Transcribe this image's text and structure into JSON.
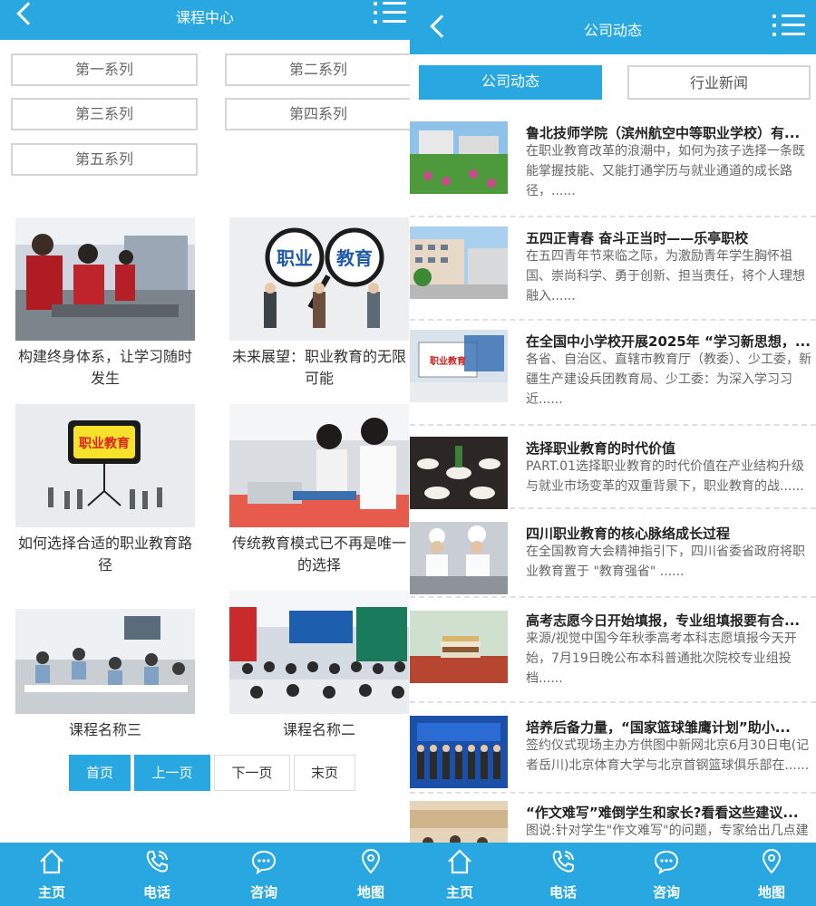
{
  "left": {
    "header_title": "课程中心",
    "series": [
      "第一系列",
      "第二系列",
      "第三系列",
      "第四系列",
      "第五系列"
    ],
    "courses": [
      {
        "caption": "构建终身体系，让学习随时发生",
        "image": "students-workshop-photo"
      },
      {
        "caption": "未来展望：职业教育的无限可能",
        "image": "magnifier-vocational-photo"
      },
      {
        "caption": "如何选择合适的职业教育路径",
        "image": "vocational-sign-photo"
      },
      {
        "caption": "传统教育模式已不再是唯一的选择",
        "image": "students-electronics-photo"
      },
      {
        "caption": "课程名称三",
        "image": "classroom-photo"
      },
      {
        "caption": "课程名称二",
        "image": "auditorium-photo"
      }
    ],
    "pagination": [
      "首页",
      "上一页",
      "下一页",
      "末页"
    ],
    "page_image_texts": {
      "magnifier_1": "职业",
      "magnifier_2": "教育",
      "sign": "职业教育"
    }
  },
  "right": {
    "header_title": "公司动态",
    "tabs": [
      "公司动态",
      "行业新闻"
    ],
    "news": [
      {
        "title": "鲁北技师学院（滨州航空中等职业学校）有...",
        "summary": "在职业教育改革的浪潮中，如何为孩子选择一条既能掌握技能、又能打通学历与就业通道的成长路径，......",
        "image": "campus-photo"
      },
      {
        "title": "五四正青春 奋斗正当时——乐亭职校",
        "summary": "在五四青年节来临之际，为激励青年学生胸怀祖国、崇尚科学、勇于创新、担当责任，将个人理想融入......",
        "image": "building-photo"
      },
      {
        "title": "在全国中小学校开展2025年 “学习新思想，...",
        "summary": "各省、自治区、直辖市教育厅（教委）、少工委，新疆生产建设兵团教育局、少工委：为深入学习习近......",
        "image": "vocational-card-photo"
      },
      {
        "title": "选择职业教育的时代价值",
        "summary": "PART.01选择职业教育的时代价值在产业结构升级与就业市场变革的双重背景下，职业教育的战......",
        "image": "banquet-photo"
      },
      {
        "title": "四川职业教育的核心脉络成长过程",
        "summary": "在全国教育大会精神指引下，四川省委省政府将职业教育置于 \"教育强省\" ......",
        "image": "chefs-photo"
      },
      {
        "title": "高考志愿今日开始填报，专业组填报要有合...",
        "summary": "来源/视觉中国今年秋季高考本科志愿填报今天开始，7月19日晚公布本科普通批次院校专业组投档......",
        "image": "books-photo"
      },
      {
        "title": "培养后备力量，“国家篮球雏鹰计划”助小...",
        "summary": "签约仪式现场主办方供图中新网北京6月30日电(记者岳川)北京体育大学与北京首钢篮球俱乐部在......",
        "image": "stage-group-photo"
      },
      {
        "title": "“作文难写”难倒学生和家长?看看这些建议...",
        "summary": "图说:针对学生\"作文难写\"的问题，专家给出几点建",
        "image": "meeting-photo"
      }
    ]
  },
  "footer": [
    "主页",
    "电话",
    "咨询",
    "地图"
  ],
  "colors": {
    "brand": "#28a7e1",
    "border": "#d5d5d5",
    "text": "#333333"
  }
}
